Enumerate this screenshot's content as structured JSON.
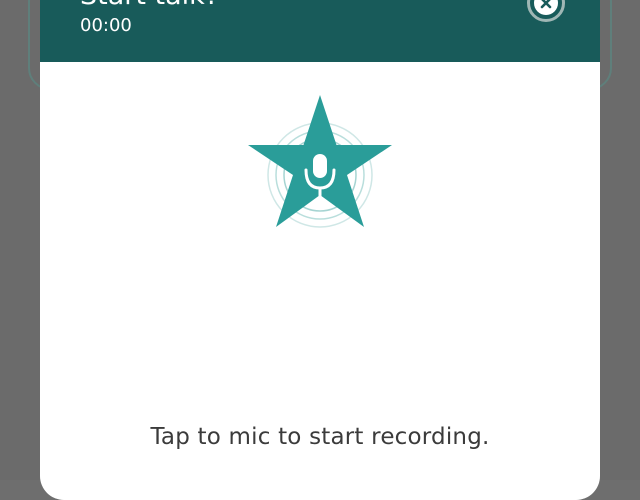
{
  "dialog": {
    "title": "Start talk?",
    "timer": "00:00",
    "close_icon": "close-circle-icon",
    "mic_icon": "microphone-icon",
    "badge_shape": "star",
    "instruction": "Tap to mic to start recording."
  },
  "colors": {
    "header_bg": "#185b5a",
    "accent": "#2a9d99",
    "dialog_bg": "#ffffff",
    "backdrop": "#6b6b6b"
  }
}
